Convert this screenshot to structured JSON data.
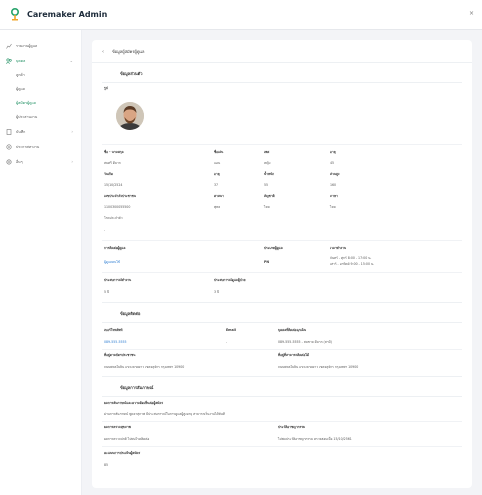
{
  "app": {
    "title": "Caremaker Admin",
    "close_glyph": "×"
  },
  "sidebar": {
    "items": [
      {
        "label": "รายงานผู้ดูแล",
        "icon": "chart-icon"
      },
      {
        "label": "บุคคล",
        "icon": "users-icon",
        "chevron": "⌄"
      },
      {
        "label": "ลูกค้า"
      },
      {
        "label": "ผู้ดูแล"
      },
      {
        "label": "ผู้สมัครผู้ดูแล"
      },
      {
        "label": "ผู้ประสานงาน"
      },
      {
        "label": "บันทึก",
        "icon": "file-icon",
        "chevron": "›"
      },
      {
        "label": "ประกาศหางาน",
        "icon": "gear-icon"
      },
      {
        "label": "อื่นๆ",
        "icon": "settings-icon",
        "chevron": "›"
      }
    ]
  },
  "header": {
    "back": "‹",
    "title": "ข้อมูลผู้สมัครผู้ดูแล"
  },
  "personal": {
    "title": "ข้อมูลส่วนตัว",
    "photo_label": "รูป",
    "rows": [
      [
        "ชื่อ - นามสกุล",
        "ชื่อเล่น",
        "เพศ",
        "อายุ"
      ],
      [
        "สมศรี ดีมาก",
        "แอน",
        "หญิง",
        "45"
      ],
      [
        "วันเกิด",
        "อายุ",
        "น้ำหนัก",
        "ส่วนสูง"
      ],
      [
        "15/10/2524",
        "37",
        "55",
        "160"
      ],
      [
        "เลขประจำตัวประชาชน",
        "ศาสนา",
        "สัญชาติ",
        "ภาษา"
      ],
      [
        "1100300055500",
        "พุทธ",
        "ไทย",
        "ไทย"
      ]
    ],
    "extra_label": "โรคประจำตัว",
    "extra_value": "-"
  },
  "job": {
    "headers": [
      "การติดต่อผู้ดูแล",
      "ประเภทผู้ดูแล",
      "เวลาทำงาน"
    ],
    "values": [
      "ผู้ดูแลคนไข้",
      "PN",
      "จันทร์ - ศุกร์ 8:00 - 17:00 น."
    ],
    "values_second": [
      "",
      "",
      "เสาร์ - อาทิตย์ 9:00 - 15:00 น."
    ],
    "headers2": [
      "ประสบการณ์ทำงาน",
      "ประสบการณ์ดูแลผู้ป่วย"
    ],
    "values2": [
      "5 ปี",
      "3 ปี"
    ]
  },
  "contact": {
    "title": "ข้อมูลติดต่อ",
    "headers": [
      "เบอร์โทรศัพท์",
      "Email",
      "บุคคลที่ติดต่อฉุกเฉิน"
    ],
    "values": [
      "089-555-5555",
      "-",
      "089-555-5555 - สมชาย ดีมาก (สามี)"
    ],
    "addr_headers": [
      "ที่อยู่ตามบัตรประชาชน",
      "ที่อยู่ที่สามารถติดต่อได้"
    ],
    "addr_values": [
      "ถนนพหลโยธิน แขวงลาดยาว เขตจตุจักร กรุงเทพฯ 10900",
      "ถนนพหลโยธิน แขวงลาดยาว เขตจตุจักร กรุงเทพฯ 10900"
    ]
  },
  "health": {
    "title": "ข้อมูลการสัมภาษณ์",
    "label1": "ผลการสัมภาษณ์และความคิดเห็นต่อผู้สมัคร",
    "value1": "ผ่านการสัมภาษณ์ พูดจาสุภาพ มีประสบการณ์ในการดูแลผู้สูงอายุ สามารถเริ่มงานได้ทันที",
    "headers": [
      "ผลการตรวจสุขภาพ",
      "ประวัติอาชญากรรม"
    ],
    "values": [
      "ผลการตรวจปกติ ไม่พบโรคติดต่อ",
      "ไม่พบประวัติอาชญากรรม ตรวจสอบเมื่อ 15/10/2561"
    ],
    "label2": "คะแนนการประเมินผู้สมัคร",
    "value2": "85"
  },
  "colors": {
    "accent": "#1a8d5f",
    "link": "#2a7bd1"
  }
}
